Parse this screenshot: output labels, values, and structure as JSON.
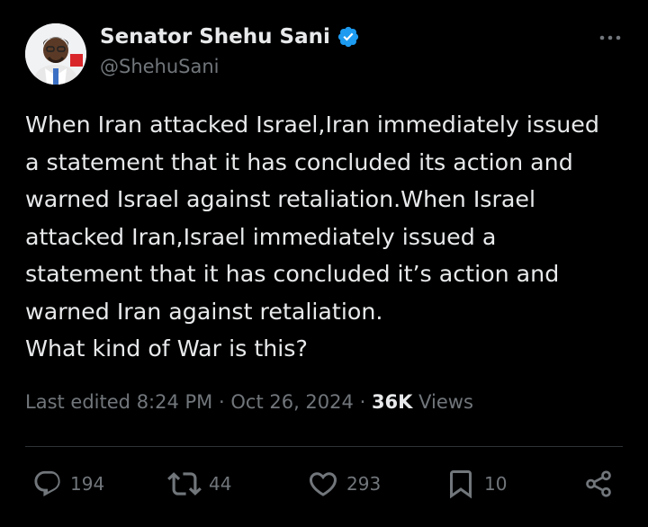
{
  "author": {
    "display_name": "Senator Shehu Sani",
    "handle": "@ShehuSani",
    "verified": true,
    "verified_color": "#1d9bf0"
  },
  "tweet": {
    "text": "When Iran attacked Israel,Iran immediately issued\na statement that it has concluded its action and\nwarned Israel against retaliation.When Israel\nattacked Iran,Israel immediately issued a\nstatement that it has concluded it’s action and\nwarned Iran against retaliation.\nWhat kind of War is this?"
  },
  "meta": {
    "edited_label": "Last edited",
    "time": "8:24 PM",
    "date": "Oct 26, 2024",
    "separator": "·",
    "views_count": "36K",
    "views_label": "Views"
  },
  "actions": {
    "replies": "194",
    "reposts": "44",
    "likes": "293",
    "bookmarks": "10"
  },
  "icons": {
    "more": "more-horizontal-icon",
    "reply": "reply-icon",
    "repost": "repost-icon",
    "like": "heart-icon",
    "bookmark": "bookmark-icon",
    "share": "share-icon"
  },
  "colors": {
    "background": "#000000",
    "text": "#e7e9ea",
    "secondary": "#71767b",
    "divider": "#2f3336"
  }
}
